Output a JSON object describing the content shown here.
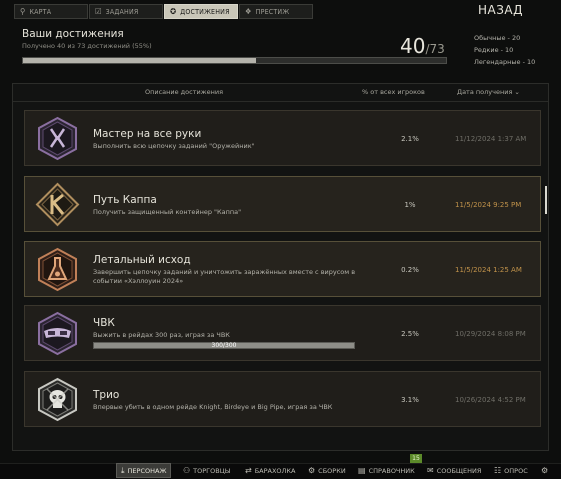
{
  "tabs": [
    {
      "label": "КАРТА",
      "icon": "map-pin-icon"
    },
    {
      "label": "ЗАДАНИЯ",
      "icon": "checklist-icon"
    },
    {
      "label": "ДОСТИЖЕНИЯ",
      "icon": "gear-badge-icon",
      "active": true
    },
    {
      "label": "ПРЕСТИЖ",
      "icon": "prestige-icon"
    }
  ],
  "back_label": "НАЗАД",
  "summary": {
    "title": "Ваши достижения",
    "subtitle": "Получено 40 из 73 достижений (55%)",
    "count": "40",
    "total": "/73",
    "progress_fraction": 0.55,
    "rarity": [
      "Обычные - 20",
      "Редкие - 10",
      "Легендарные - 10"
    ]
  },
  "columns": {
    "description": "Описание достижения",
    "percent": "% от всех игроков",
    "date": "Дата получения ⌄"
  },
  "achievements": [
    {
      "title": "Мастер на все руки",
      "desc": "Выполнить всю цепочку заданий \"Оружейник\"",
      "pct": "2.1%",
      "date": "11/12/2024 1:37 AM",
      "date_color": "gray",
      "badge": "tools-icon",
      "badge_color": "#8a6fa0"
    },
    {
      "title": "Путь Каппа",
      "desc": "Получить защищенный контейнер \"Каппа\"",
      "pct": "1%",
      "date": "11/5/2024 9:25 PM",
      "date_color": "gold",
      "badge": "kappa-icon",
      "badge_color": "#b08e5e"
    },
    {
      "title": "Летальный исход",
      "desc": "Завершить цепочку заданий и уничтожить заражённых вместе с вирусом в событии «Хэллоуин 2024»",
      "pct": "0.2%",
      "date": "11/5/2024 1:25 AM",
      "date_color": "gold",
      "badge": "flask-icon",
      "badge_color": "#c08058"
    },
    {
      "title": "ЧВК",
      "desc": "Выжить в рейдах 300 раз, играя за ЧВК",
      "pct": "2.5%",
      "date": "10/29/2024 8:08 PM",
      "date_color": "gray",
      "badge": "goggles-icon",
      "badge_color": "#8a6fa0",
      "progress": "300/300",
      "progress_fraction": 1.0
    },
    {
      "title": "Трио",
      "desc": "Впервые убить в одном рейде Knight, Birdeye и Big Pipe, играя за ЧВК",
      "pct": "3.1%",
      "date": "10/26/2024 4:52 PM",
      "date_color": "gray",
      "badge": "skull-icon",
      "badge_color": "#c8c8c2"
    }
  ],
  "bottom_nav": [
    {
      "label": "ПЕРСОНАЖ",
      "icon": "character-icon",
      "active": true
    },
    {
      "label": "ТОРГОВЦЫ",
      "icon": "trader-icon"
    },
    {
      "label": "БАРАХОЛКА",
      "icon": "flea-market-icon"
    },
    {
      "label": "СБОРКИ",
      "icon": "builds-icon"
    },
    {
      "label": "СПРАВОЧНИК",
      "icon": "handbook-icon"
    },
    {
      "label": "СООБЩЕНИЯ",
      "icon": "messages-icon"
    },
    {
      "label": "ОПРОС",
      "icon": "survey-icon"
    }
  ],
  "notification_count": "15"
}
